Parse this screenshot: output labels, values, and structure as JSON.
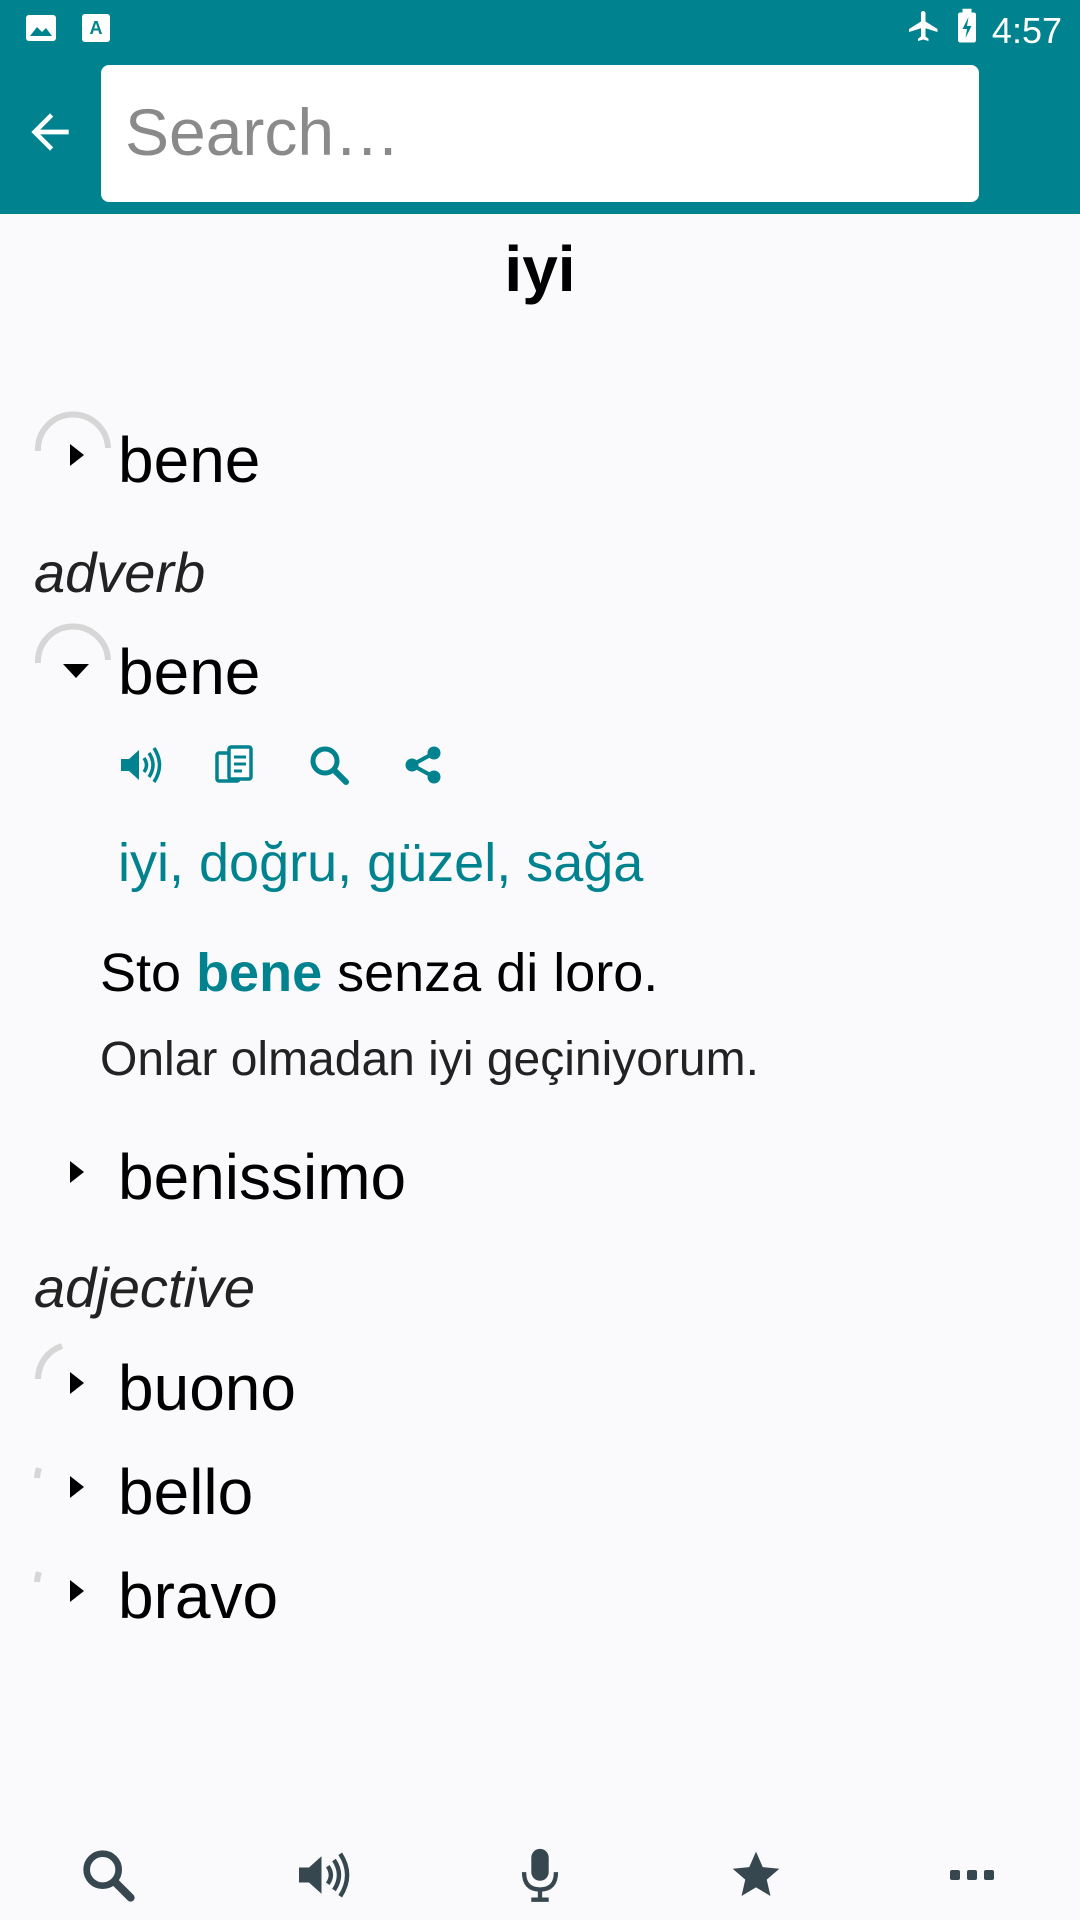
{
  "status_bar": {
    "time": "4:57",
    "left_icons": [
      "image-icon",
      "keyboard-icon"
    ],
    "right_icons": [
      "airplane-icon",
      "battery-charging-icon"
    ]
  },
  "search": {
    "placeholder": "Search…",
    "value": ""
  },
  "headword": "iyi",
  "entries": [
    {
      "word": "bene",
      "expanded": false
    },
    {
      "word": "bene",
      "expanded": true
    },
    {
      "word": "benissimo",
      "expanded": false
    },
    {
      "word": "buono",
      "expanded": false
    },
    {
      "word": "bello",
      "expanded": false
    },
    {
      "word": "bravo",
      "expanded": false
    }
  ],
  "parts_of_speech": [
    "adverb",
    "adjective"
  ],
  "expanded_entry": {
    "actions": [
      "speaker-icon",
      "copy-icon",
      "search-icon",
      "share-icon"
    ],
    "translations": "iyi, doğru, güzel, sağa",
    "example": {
      "before": "Sto ",
      "highlight": "bene",
      "after": " senza di loro."
    },
    "example_translation": "Onlar olmadan iyi geçiniyorum."
  },
  "bottom_bar": {
    "items": [
      "search-icon",
      "speaker-icon",
      "microphone-icon",
      "star-icon",
      "more-icon"
    ]
  },
  "colors": {
    "accent": "#00838f",
    "background": "#fafafc",
    "icon": "#37474f"
  }
}
